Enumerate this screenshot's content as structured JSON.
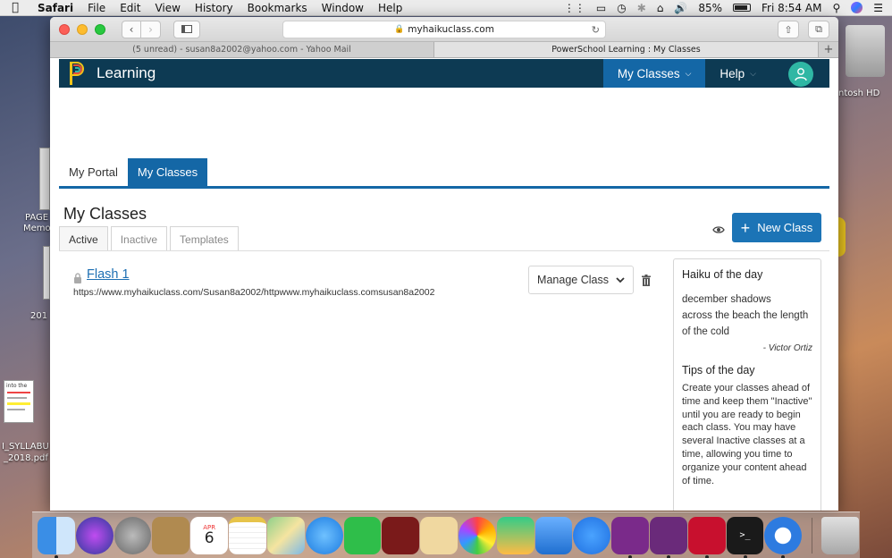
{
  "menubar": {
    "app": "Safari",
    "items": [
      "File",
      "Edit",
      "View",
      "History",
      "Bookmarks",
      "Window",
      "Help"
    ],
    "battery": "85%",
    "clock": "Fri 8:54 AM"
  },
  "desktop": {
    "left_labels": [
      "PAGE",
      "Memo",
      "201",
      "into the",
      "I_SYLLABU",
      "_2018.pdf"
    ],
    "right_labels": [
      "ntosh HD"
    ]
  },
  "browser": {
    "url": "myhaikuclass.com",
    "tabs": [
      {
        "label": "(5 unread) - susan8a2002@yahoo.com - Yahoo Mail",
        "active": false
      },
      {
        "label": "PowerSchool Learning : My Classes",
        "active": true
      }
    ],
    "new_tab_label": "+"
  },
  "topnav": {
    "brand": "Learning",
    "items": [
      {
        "label": "My Classes",
        "selected": true
      },
      {
        "label": "Help",
        "selected": false
      }
    ]
  },
  "portal_tabs": [
    {
      "label": "My Portal",
      "selected": false
    },
    {
      "label": "My Classes",
      "selected": true
    }
  ],
  "main": {
    "title": "My Classes",
    "subtabs": [
      {
        "label": "Active",
        "selected": true
      },
      {
        "label": "Inactive",
        "selected": false
      },
      {
        "label": "Templates",
        "selected": false
      }
    ],
    "new_class_label": "New Class",
    "classes": [
      {
        "name": "Flash 1",
        "url": "https://www.myhaikuclass.com/Susan8a2002/httpwww.myhaikuclass.comsusan8a2002",
        "manage_label": "Manage Class"
      }
    ]
  },
  "sidebar": {
    "haiku_heading": "Haiku of the day",
    "haiku_lines": [
      "december shadows",
      "across the beach the length",
      "of the cold"
    ],
    "haiku_author": "- Victor Ortiz",
    "tips_heading": "Tips of the day",
    "tips_text": "Create your classes ahead of time and keep them \"Inactive\" until you are ready to begin each class. You may have several Inactive classes at a time, allowing you time to organize your content ahead of time."
  },
  "dock": {
    "calendar_month": "APR",
    "calendar_day": "6"
  },
  "colors": {
    "nav_bg": "#0d3a53",
    "accent_blue": "#1467a6",
    "button_blue": "#1c74b6",
    "link_blue": "#1d6fb3",
    "avatar_teal": "#2fb7a4"
  }
}
